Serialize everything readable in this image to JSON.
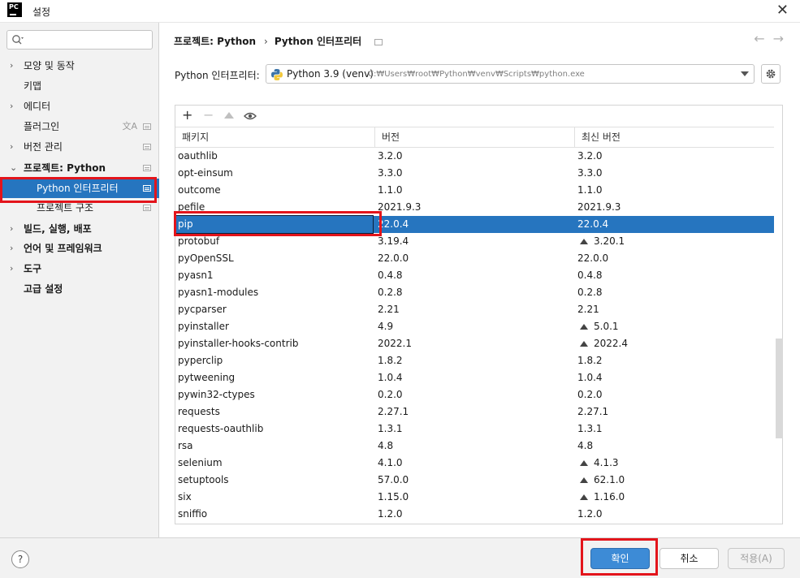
{
  "window": {
    "title": "설정",
    "app_icon_text": "PC"
  },
  "search": {
    "value": "",
    "placeholder": ""
  },
  "sidebar": {
    "items": [
      {
        "label": "모양 및 동작",
        "chevron": "›"
      },
      {
        "label": "키맵"
      },
      {
        "label": "에디터",
        "chevron": "›"
      },
      {
        "label": "플러그인"
      },
      {
        "label": "버전 관리",
        "chevron": "›"
      },
      {
        "label": "프로젝트: Python",
        "chevron": "⌄"
      },
      {
        "label": "Python 인터프리터"
      },
      {
        "label": "프로젝트 구조"
      },
      {
        "label": "빌드, 실행, 배포",
        "chevron": "›"
      },
      {
        "label": "언어 및 프레임워크",
        "chevron": "›"
      },
      {
        "label": "도구",
        "chevron": "›"
      },
      {
        "label": "고급 설정"
      }
    ]
  },
  "breadcrumb": {
    "project": "프로젝트: Python",
    "separator": "›",
    "page": "Python 인터프리터"
  },
  "interpreter": {
    "label": "Python 인터프리터:",
    "name": "Python 3.9 (venv)",
    "path": "C:₩Users₩root₩Python₩venv₩Scripts₩python.exe"
  },
  "packages": {
    "columns": {
      "name": "패키지",
      "version": "버전",
      "latest": "최신 버전"
    },
    "rows": [
      {
        "name": "oauthlib",
        "version": "3.2.0",
        "latest": "3.2.0"
      },
      {
        "name": "opt-einsum",
        "version": "3.3.0",
        "latest": "3.3.0"
      },
      {
        "name": "outcome",
        "version": "1.1.0",
        "latest": "1.1.0"
      },
      {
        "name": "pefile",
        "version": "2021.9.3",
        "latest": "2021.9.3"
      },
      {
        "name": "pip",
        "version": "22.0.4",
        "latest": "22.0.4"
      },
      {
        "name": "protobuf",
        "version": "3.19.4",
        "latest": "3.20.1"
      },
      {
        "name": "pyOpenSSL",
        "version": "22.0.0",
        "latest": "22.0.0"
      },
      {
        "name": "pyasn1",
        "version": "0.4.8",
        "latest": "0.4.8"
      },
      {
        "name": "pyasn1-modules",
        "version": "0.2.8",
        "latest": "0.2.8"
      },
      {
        "name": "pycparser",
        "version": "2.21",
        "latest": "2.21"
      },
      {
        "name": "pyinstaller",
        "version": "4.9",
        "latest": "5.0.1"
      },
      {
        "name": "pyinstaller-hooks-contrib",
        "version": "2022.1",
        "latest": "2022.4"
      },
      {
        "name": "pyperclip",
        "version": "1.8.2",
        "latest": "1.8.2"
      },
      {
        "name": "pytweening",
        "version": "1.0.4",
        "latest": "1.0.4"
      },
      {
        "name": "pywin32-ctypes",
        "version": "0.2.0",
        "latest": "0.2.0"
      },
      {
        "name": "requests",
        "version": "2.27.1",
        "latest": "2.27.1"
      },
      {
        "name": "requests-oauthlib",
        "version": "1.3.1",
        "latest": "1.3.1"
      },
      {
        "name": "rsa",
        "version": "4.8",
        "latest": "4.8"
      },
      {
        "name": "selenium",
        "version": "4.1.0",
        "latest": "4.1.3"
      },
      {
        "name": "setuptools",
        "version": "57.0.0",
        "latest": "62.1.0"
      },
      {
        "name": "six",
        "version": "1.15.0",
        "latest": "1.16.0"
      },
      {
        "name": "sniffio",
        "version": "1.2.0",
        "latest": "1.2.0"
      }
    ]
  },
  "footer": {
    "help": "?",
    "ok": "확인",
    "cancel": "취소",
    "apply": "적용(A)"
  },
  "colors": {
    "selection": "#2675bf",
    "highlight_box": "#e3141b",
    "primary_button": "#3d8bd6"
  }
}
